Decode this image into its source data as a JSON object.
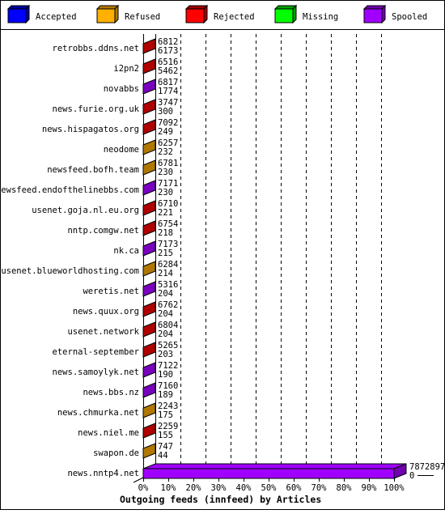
{
  "chart_data": {
    "type": "bar",
    "orientation": "horizontal",
    "style": "3d-stacked-percent",
    "title": "Outgoing feeds (innfeed) by Articles",
    "legend_position": "top",
    "legend": [
      {
        "name": "Accepted",
        "color": "#0000ff",
        "side": "#0000a0"
      },
      {
        "name": "Refused",
        "color": "#ffb000",
        "side": "#b07800"
      },
      {
        "name": "Rejected",
        "color": "#ff0000",
        "side": "#a00000"
      },
      {
        "name": "Missing",
        "color": "#00ff00",
        "side": "#00a000"
      },
      {
        "name": "Spooled",
        "color": "#a000ff",
        "side": "#7000b0"
      }
    ],
    "xticks": [
      "0%",
      "10%",
      "20%",
      "30%",
      "40%",
      "50%",
      "60%",
      "70%",
      "80%",
      "90%",
      "100%"
    ],
    "xlim": [
      0,
      100
    ],
    "grid": true,
    "rows": [
      {
        "label": "retrobbs.ddns.net",
        "top": "6812",
        "bottom": "6173",
        "color": "#b00000",
        "percent": 0
      },
      {
        "label": "i2pn2",
        "top": "6516",
        "bottom": "5462",
        "color": "#b00000",
        "percent": 0
      },
      {
        "label": "novabbs",
        "top": "6817",
        "bottom": "1774",
        "color": "#7a00c0",
        "percent": 0
      },
      {
        "label": "news.furie.org.uk",
        "top": "3747",
        "bottom": "300",
        "color": "#b00000",
        "percent": 0
      },
      {
        "label": "news.hispagatos.org",
        "top": "7092",
        "bottom": "249",
        "color": "#b00000",
        "percent": 0
      },
      {
        "label": "neodome",
        "top": "6257",
        "bottom": "232",
        "color": "#b07800",
        "percent": 0
      },
      {
        "label": "newsfeed.bofh.team",
        "top": "6781",
        "bottom": "230",
        "color": "#b07800",
        "percent": 0
      },
      {
        "label": "newsfeed.endofthelinebbs.com",
        "top": "7171",
        "bottom": "230",
        "color": "#7a00c0",
        "percent": 0
      },
      {
        "label": "usenet.goja.nl.eu.org",
        "top": "6710",
        "bottom": "221",
        "color": "#b00000",
        "percent": 0
      },
      {
        "label": "nntp.comgw.net",
        "top": "6754",
        "bottom": "218",
        "color": "#b00000",
        "percent": 0
      },
      {
        "label": "nk.ca",
        "top": "7173",
        "bottom": "215",
        "color": "#7a00c0",
        "percent": 0
      },
      {
        "label": "usenet.blueworldhosting.com",
        "top": "6284",
        "bottom": "214",
        "color": "#b07800",
        "percent": 0
      },
      {
        "label": "weretis.net",
        "top": "5316",
        "bottom": "204",
        "color": "#7a00c0",
        "percent": 0
      },
      {
        "label": "news.quux.org",
        "top": "6762",
        "bottom": "204",
        "color": "#b00000",
        "percent": 0
      },
      {
        "label": "usenet.network",
        "top": "6804",
        "bottom": "204",
        "color": "#b00000",
        "percent": 0
      },
      {
        "label": "eternal-september",
        "top": "5265",
        "bottom": "203",
        "color": "#b00000",
        "percent": 0
      },
      {
        "label": "news.samoylyk.net",
        "top": "7122",
        "bottom": "190",
        "color": "#7a00c0",
        "percent": 0
      },
      {
        "label": "news.bbs.nz",
        "top": "7160",
        "bottom": "189",
        "color": "#7a00c0",
        "percent": 0
      },
      {
        "label": "news.chmurka.net",
        "top": "2243",
        "bottom": "175",
        "color": "#b07800",
        "percent": 0
      },
      {
        "label": "news.niel.me",
        "top": "2259",
        "bottom": "155",
        "color": "#b00000",
        "percent": 0
      },
      {
        "label": "swapon.de",
        "top": "747",
        "bottom": "44",
        "color": "#b07800",
        "percent": 0
      },
      {
        "label": "news.nntp4.net",
        "top": "7872897",
        "bottom": "0",
        "color": "#a000ff",
        "percent": 100
      }
    ]
  }
}
